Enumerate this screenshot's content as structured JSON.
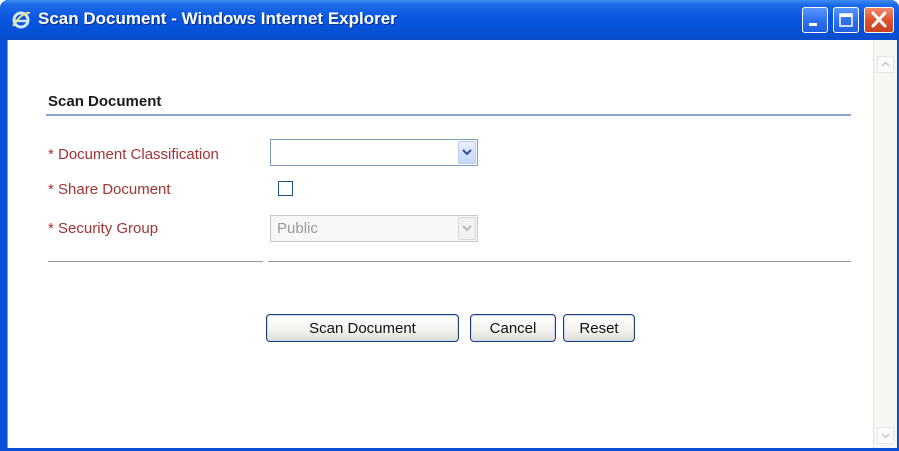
{
  "window": {
    "title": "Scan Document - Windows Internet Explorer",
    "icon": "ie-icon",
    "controls": [
      "minimize-icon",
      "maximize-icon",
      "close-icon"
    ]
  },
  "form": {
    "heading": "Scan Document",
    "fields": {
      "classification": {
        "label": "* Document Classification",
        "value": ""
      },
      "share": {
        "label": "* Share Document",
        "checked": false
      },
      "security": {
        "label": "* Security Group",
        "value": "Public",
        "disabled": true
      }
    }
  },
  "buttons": {
    "scan": "Scan Document",
    "cancel": "Cancel",
    "reset": "Reset"
  },
  "colors": {
    "title_bar": "#0a56e0",
    "label": "#a33434",
    "section_rule": "#8aa3c8"
  }
}
